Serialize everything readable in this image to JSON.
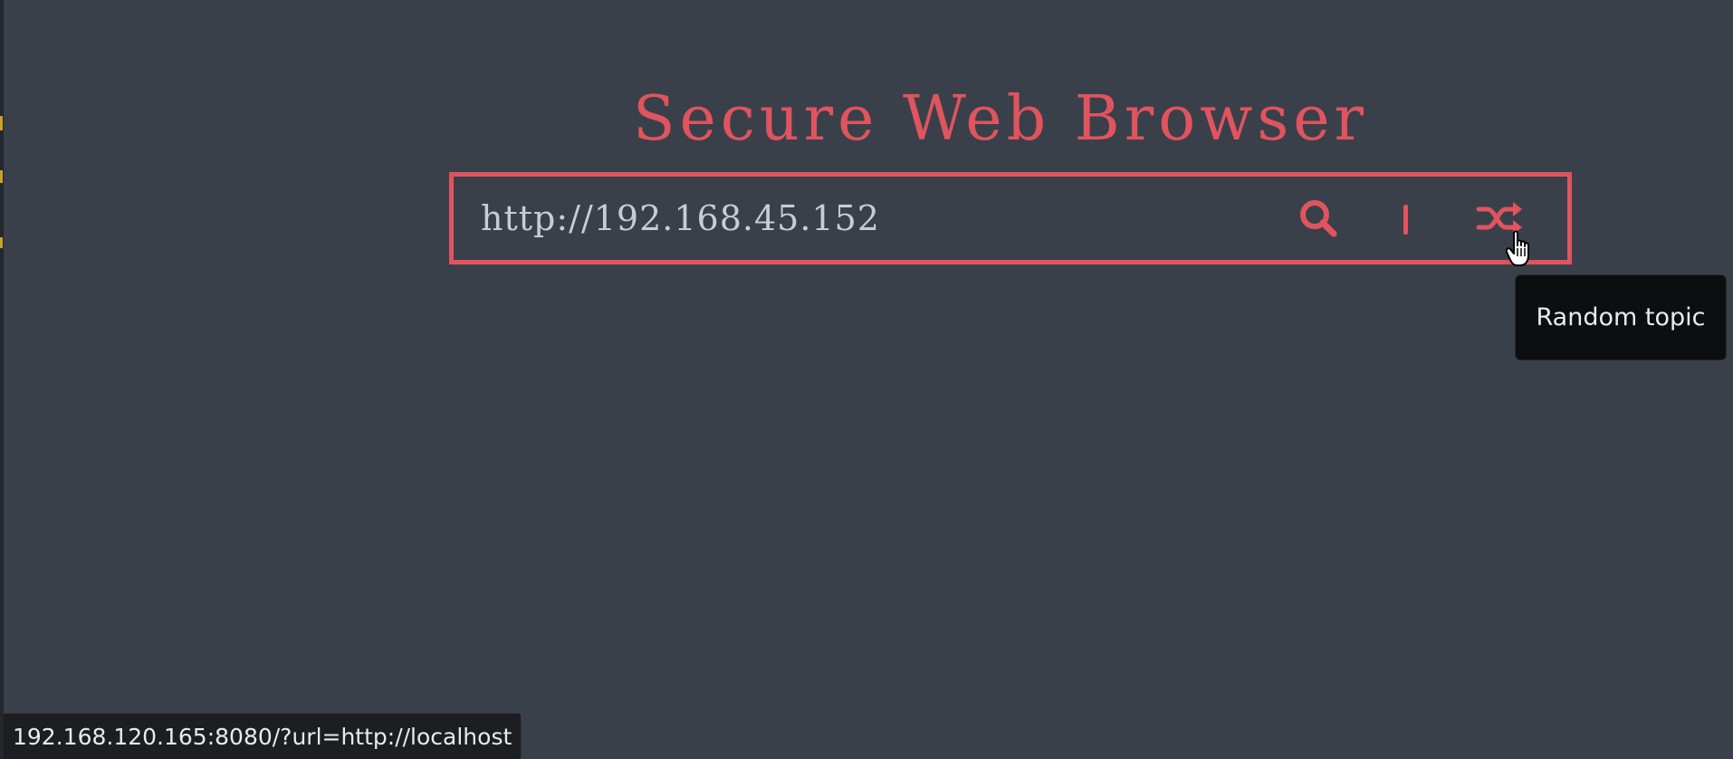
{
  "page": {
    "title": "Secure Web Browser"
  },
  "search": {
    "value": "http://192.168.45.152"
  },
  "icons": {
    "search": "search-icon",
    "divider": "divider",
    "shuffle": "shuffle-icon",
    "cursor": "hand-pointer-icon"
  },
  "tooltip": {
    "text": "Random topic"
  },
  "status_bar": {
    "url": "192.168.120.165:8080/?url=http://localhost"
  },
  "colors": {
    "background": "#3a404a",
    "accent": "#e0545f",
    "input_text": "#c9ccd1",
    "tooltip_bg": "#0d0e10",
    "status_bg": "#1c1e22"
  }
}
